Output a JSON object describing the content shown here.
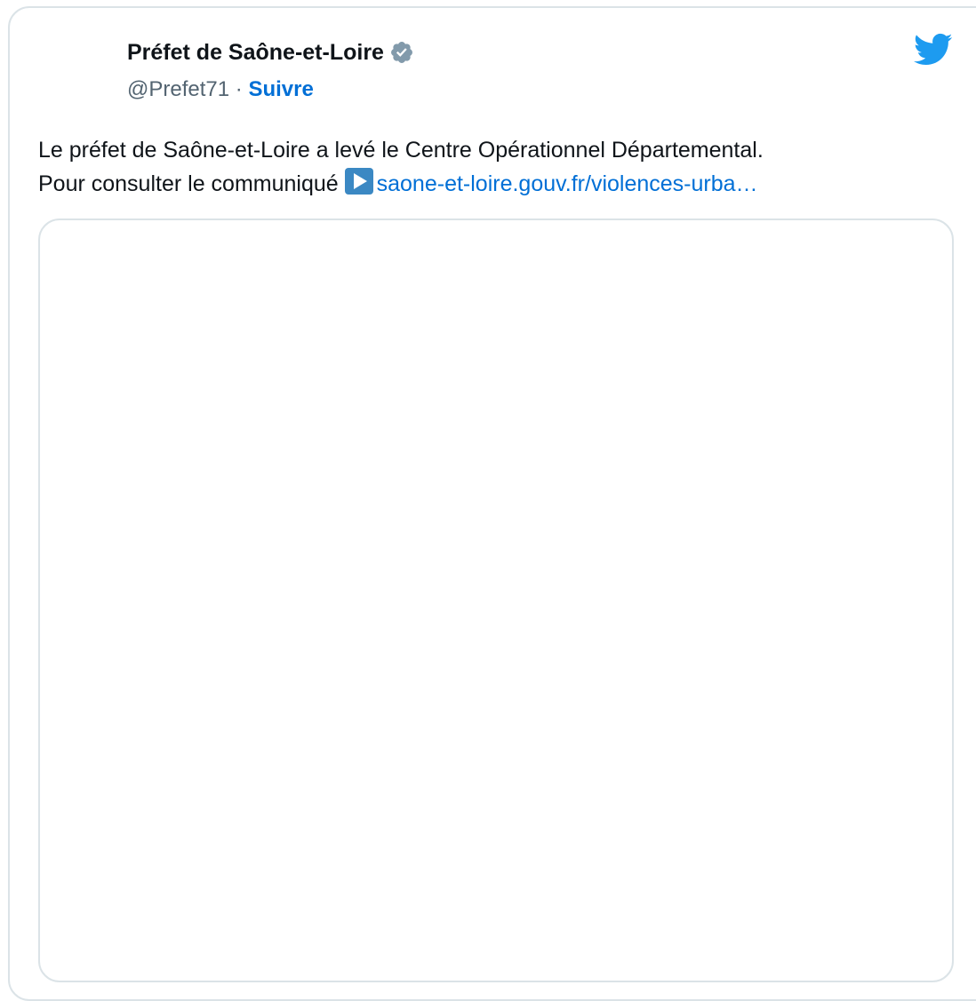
{
  "author": {
    "name": "Préfet de Saône-et-Loire",
    "handle": "@Prefet71",
    "separator": "·",
    "follow_label": "Suivre",
    "verified": true
  },
  "tweet": {
    "line1": "Le préfet de Saône-et-Loire a levé le Centre Opérationnel Départemental.",
    "line2_prefix": "Pour consulter le communiqué",
    "emoji": "play-button-emoji",
    "link_text": "saone-et-loire.gouv.fr/violences-urba…"
  },
  "icons": {
    "brand": "twitter-bird-icon",
    "verified": "verified-badge-icon"
  },
  "colors": {
    "text": "#0f1419",
    "secondary_text": "#536471",
    "link": "#006fd6",
    "twitter_blue": "#1d9bf0",
    "border": "#dbe3e7",
    "verified_badge": "#829aab"
  }
}
